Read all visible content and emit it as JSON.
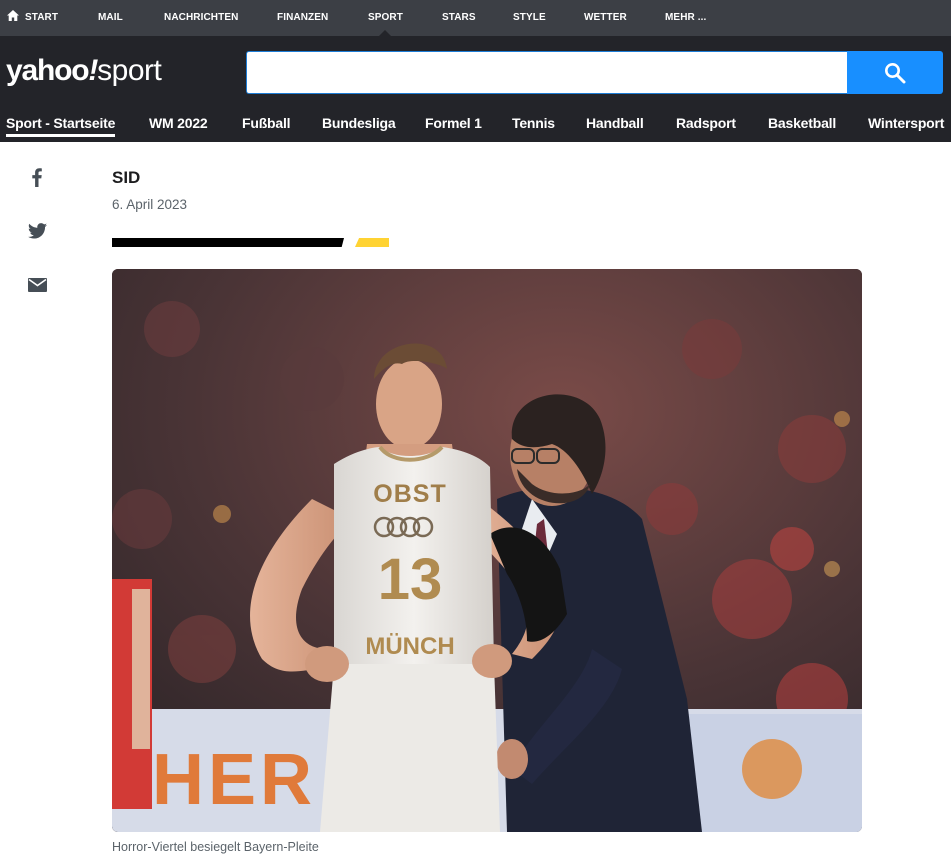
{
  "top_nav": {
    "items": [
      {
        "label": "START"
      },
      {
        "label": "MAIL"
      },
      {
        "label": "NACHRICHTEN"
      },
      {
        "label": "FINANZEN"
      },
      {
        "label": "SPORT"
      },
      {
        "label": "STARS"
      },
      {
        "label": "STYLE"
      },
      {
        "label": "WETTER"
      },
      {
        "label": "MEHR ..."
      }
    ],
    "active": "SPORT"
  },
  "header": {
    "logo": {
      "part1": "yahoo",
      "bang": "!",
      "part2": "sport"
    },
    "search": {
      "value": "",
      "placeholder": "",
      "button_icon": "search-icon"
    }
  },
  "sport_nav": {
    "tabs": [
      {
        "label": "Sport - Startseite"
      },
      {
        "label": "WM 2022"
      },
      {
        "label": "Fußball"
      },
      {
        "label": "Bundesliga"
      },
      {
        "label": "Formel 1"
      },
      {
        "label": "Tennis"
      },
      {
        "label": "Handball"
      },
      {
        "label": "Radsport"
      },
      {
        "label": "Basketball"
      },
      {
        "label": "Wintersport"
      }
    ],
    "active": "Sport - Startseite"
  },
  "share": {
    "icons": [
      "facebook-icon",
      "twitter-icon",
      "mail-icon"
    ]
  },
  "article": {
    "author": "SID",
    "date": "6. April 2023",
    "image": {
      "jersey_name": "OBST",
      "jersey_number": "13",
      "jersey_text": "MÜNCH",
      "banner_text": "HER"
    },
    "caption": "Horror-Viertel besiegelt Bayern-Pleite"
  },
  "colors": {
    "top_bar": "#3c3f45",
    "header": "#232429",
    "search_button": "#188fff",
    "accent_yellow": "#ffd333"
  }
}
